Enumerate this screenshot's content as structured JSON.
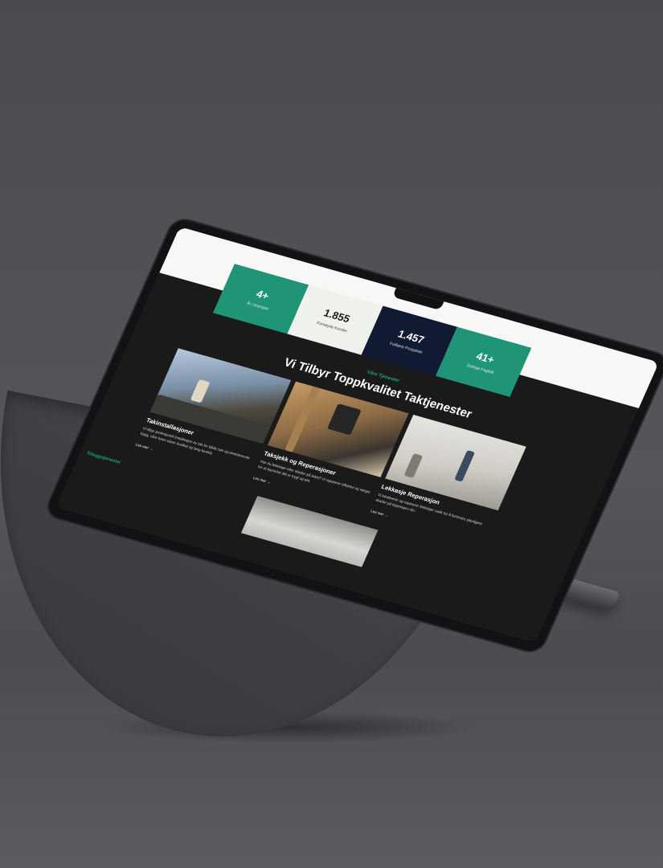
{
  "stats": [
    {
      "value": "4+",
      "label": "År i bransjen",
      "color": "#1f9477"
    },
    {
      "value": "1.855",
      "label": "Fornøyde Kunder",
      "color": "#eef1ec"
    },
    {
      "value": "1.457",
      "label": "Fullførte Prosjekter",
      "color": "#111a33"
    },
    {
      "value": "41+",
      "label": "Dyktige Fagfolk",
      "color": "#1f9477"
    }
  ],
  "services": {
    "eyebrow": "Våre Tjenester",
    "title": "Vi Tilbyr Toppkvalitet Taktjenester",
    "cards": [
      {
        "title": "Takinstallasjoner",
        "text": "Vi tilbyr profesjonell installasjon av tak for både nye og eksisterende bygg, våre team sikrer kvalitet og lang levetid.",
        "link": "Les mer →"
      },
      {
        "title": "Taksjekk og Reperasjoner",
        "text": "Har du lekkasjer eller skader på taket? Vi reparerer effektivt og sørger for at hjemmet ditt er trygt og tett.",
        "link": "Les mer →"
      },
      {
        "title": "Lekkasje Reperasjon",
        "text": "Vi lokaliserer og reparerer lekkasjer raskt for å forhindre ytterligere skader på bygningen din.",
        "link": "Les mer →"
      }
    ]
  },
  "secondary": {
    "eyebrow": "Tilleggstjenester"
  }
}
